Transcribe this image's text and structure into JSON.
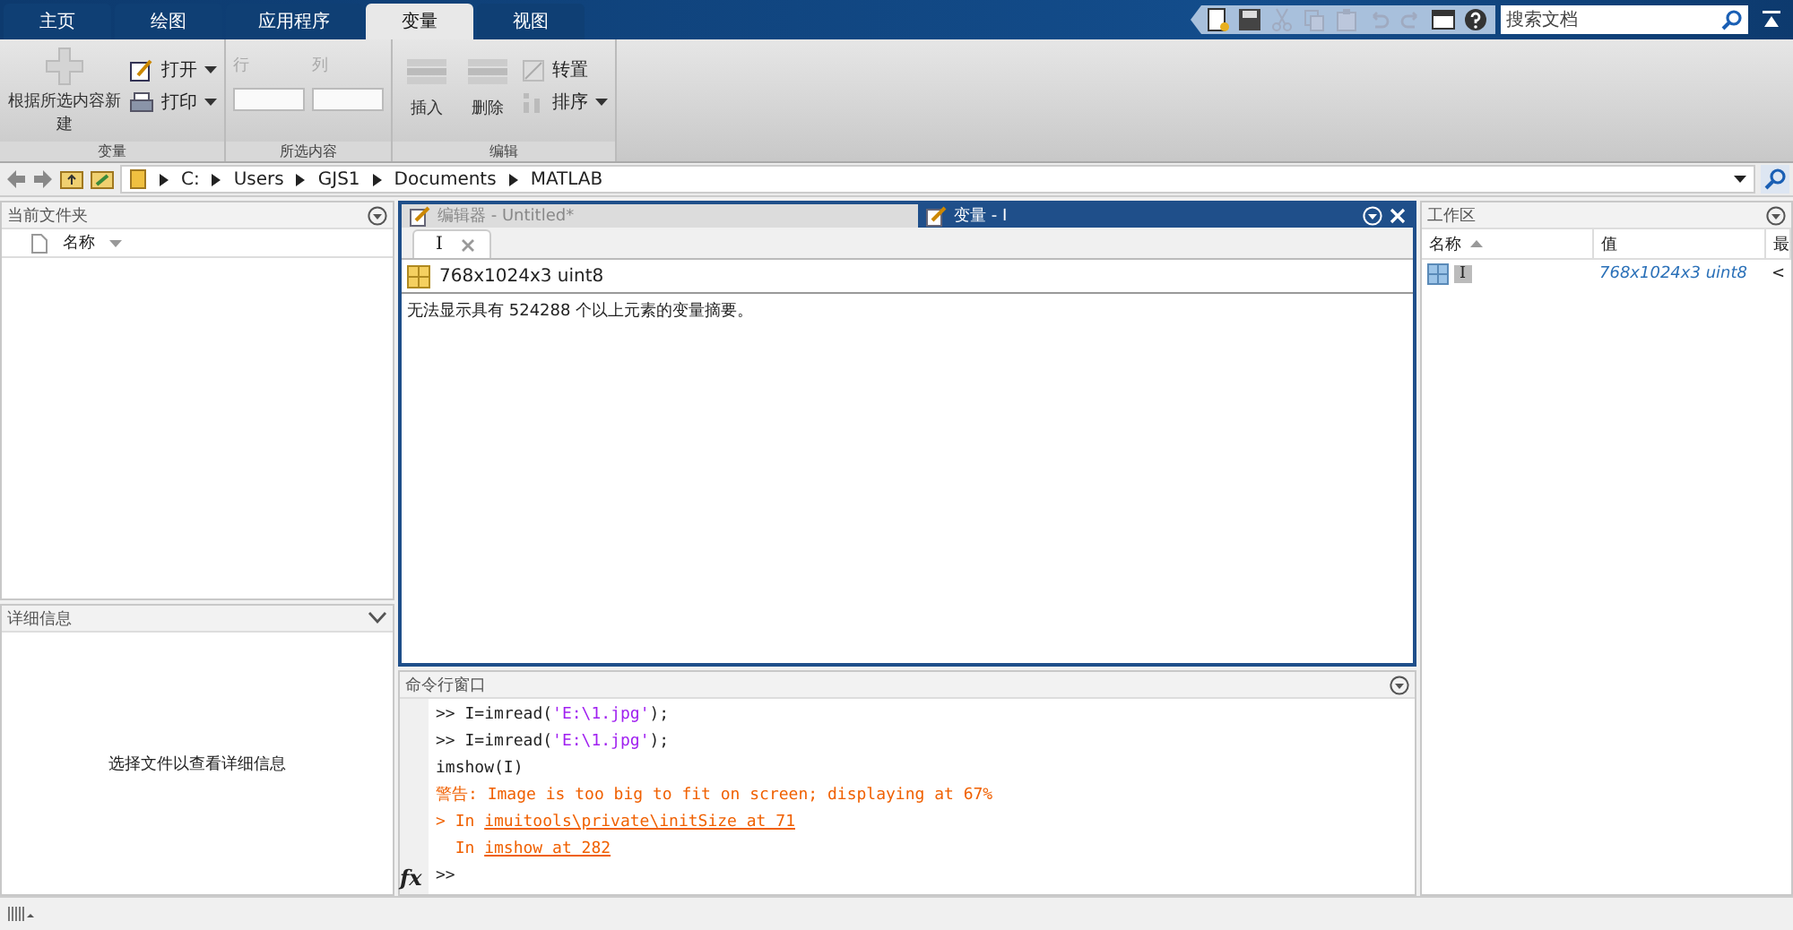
{
  "toolstrip": {
    "tabs": [
      {
        "label": "主页",
        "selected": false
      },
      {
        "label": "绘图",
        "selected": false
      },
      {
        "label": "应用程序",
        "selected": false
      },
      {
        "label": "变量",
        "selected": true
      },
      {
        "label": "视图",
        "selected": false
      }
    ],
    "quick_access": [
      {
        "kind": "new",
        "disabled": false
      },
      {
        "kind": "save",
        "disabled": false
      },
      {
        "kind": "cut",
        "disabled": true
      },
      {
        "kind": "copy",
        "disabled": true
      },
      {
        "kind": "paste",
        "disabled": true
      },
      {
        "kind": "undo",
        "disabled": true
      },
      {
        "kind": "redo",
        "disabled": true
      },
      {
        "kind": "layout",
        "disabled": false
      },
      {
        "kind": "help",
        "disabled": false
      }
    ],
    "search": {
      "placeholder": "搜索文档"
    }
  },
  "ribbon": {
    "new_button": "根据所选内容新建",
    "open_button": "打开",
    "print_button": "打印",
    "variable_group": "变量",
    "row_field": {
      "label": "行",
      "disabled": true
    },
    "column_field": {
      "label": "列",
      "disabled": true
    },
    "selection_group": "所选内容",
    "insert_button": "插入",
    "delete_button": "删除",
    "transpose_button": "转置",
    "sort_button": "排序",
    "edit_group": "编辑"
  },
  "address": {
    "segments": [
      "C:",
      "Users",
      "GJS1",
      "Documents",
      "MATLAB"
    ]
  },
  "current_folder": {
    "title": "当前文件夹",
    "column": "名称"
  },
  "details": {
    "title": "详细信息",
    "message": "选择文件以查看详细信息"
  },
  "editor": {
    "tabs": [
      {
        "title": "编辑器 - Untitled*",
        "selected": false
      },
      {
        "title": "变量 - I",
        "selected": true
      }
    ],
    "documents": [
      {
        "label": "I",
        "selected": true
      }
    ],
    "info": "768x1024x3 uint8",
    "message": "无法显示具有 524288 个以上元素的变量摘要。"
  },
  "command_window": {
    "title": "命令行窗口",
    "lines": [
      {
        "parts": [
          {
            "kind": "prompt",
            "text": ">> "
          },
          {
            "kind": "code",
            "text": "I=imread("
          },
          {
            "kind": "string",
            "text": "'E:\\1.jpg'"
          },
          {
            "kind": "code",
            "text": ");"
          }
        ]
      },
      {
        "parts": [
          {
            "kind": "prompt",
            "text": ">> "
          },
          {
            "kind": "code",
            "text": "I=imread("
          },
          {
            "kind": "string",
            "text": "'E:\\1.jpg'"
          },
          {
            "kind": "code",
            "text": ");"
          }
        ]
      },
      {
        "parts": [
          {
            "kind": "code",
            "text": "imshow(I)"
          }
        ]
      },
      {
        "parts": [
          {
            "kind": "warning",
            "text": "警告: Image is too big to fit on screen; displaying at 67%"
          }
        ]
      },
      {
        "parts": [
          {
            "kind": "warning",
            "text": "> In "
          },
          {
            "kind": "link",
            "text": "imuitools\\private\\initSize at 71"
          }
        ]
      },
      {
        "parts": [
          {
            "kind": "warning",
            "text": "  In "
          },
          {
            "kind": "link",
            "text": "imshow at 282"
          }
        ]
      }
    ],
    "function_button": "fx",
    "prompt": ">>"
  },
  "workspace": {
    "title": "工作区",
    "columns": [
      {
        "label": "名称",
        "sorted": true
      },
      {
        "label": "值",
        "sorted": false
      },
      {
        "label": "最",
        "sorted": false
      }
    ],
    "rows": [
      {
        "cells": [
          "I",
          "768x1024x3 uint8",
          "<"
        ],
        "selected": true
      }
    ]
  }
}
